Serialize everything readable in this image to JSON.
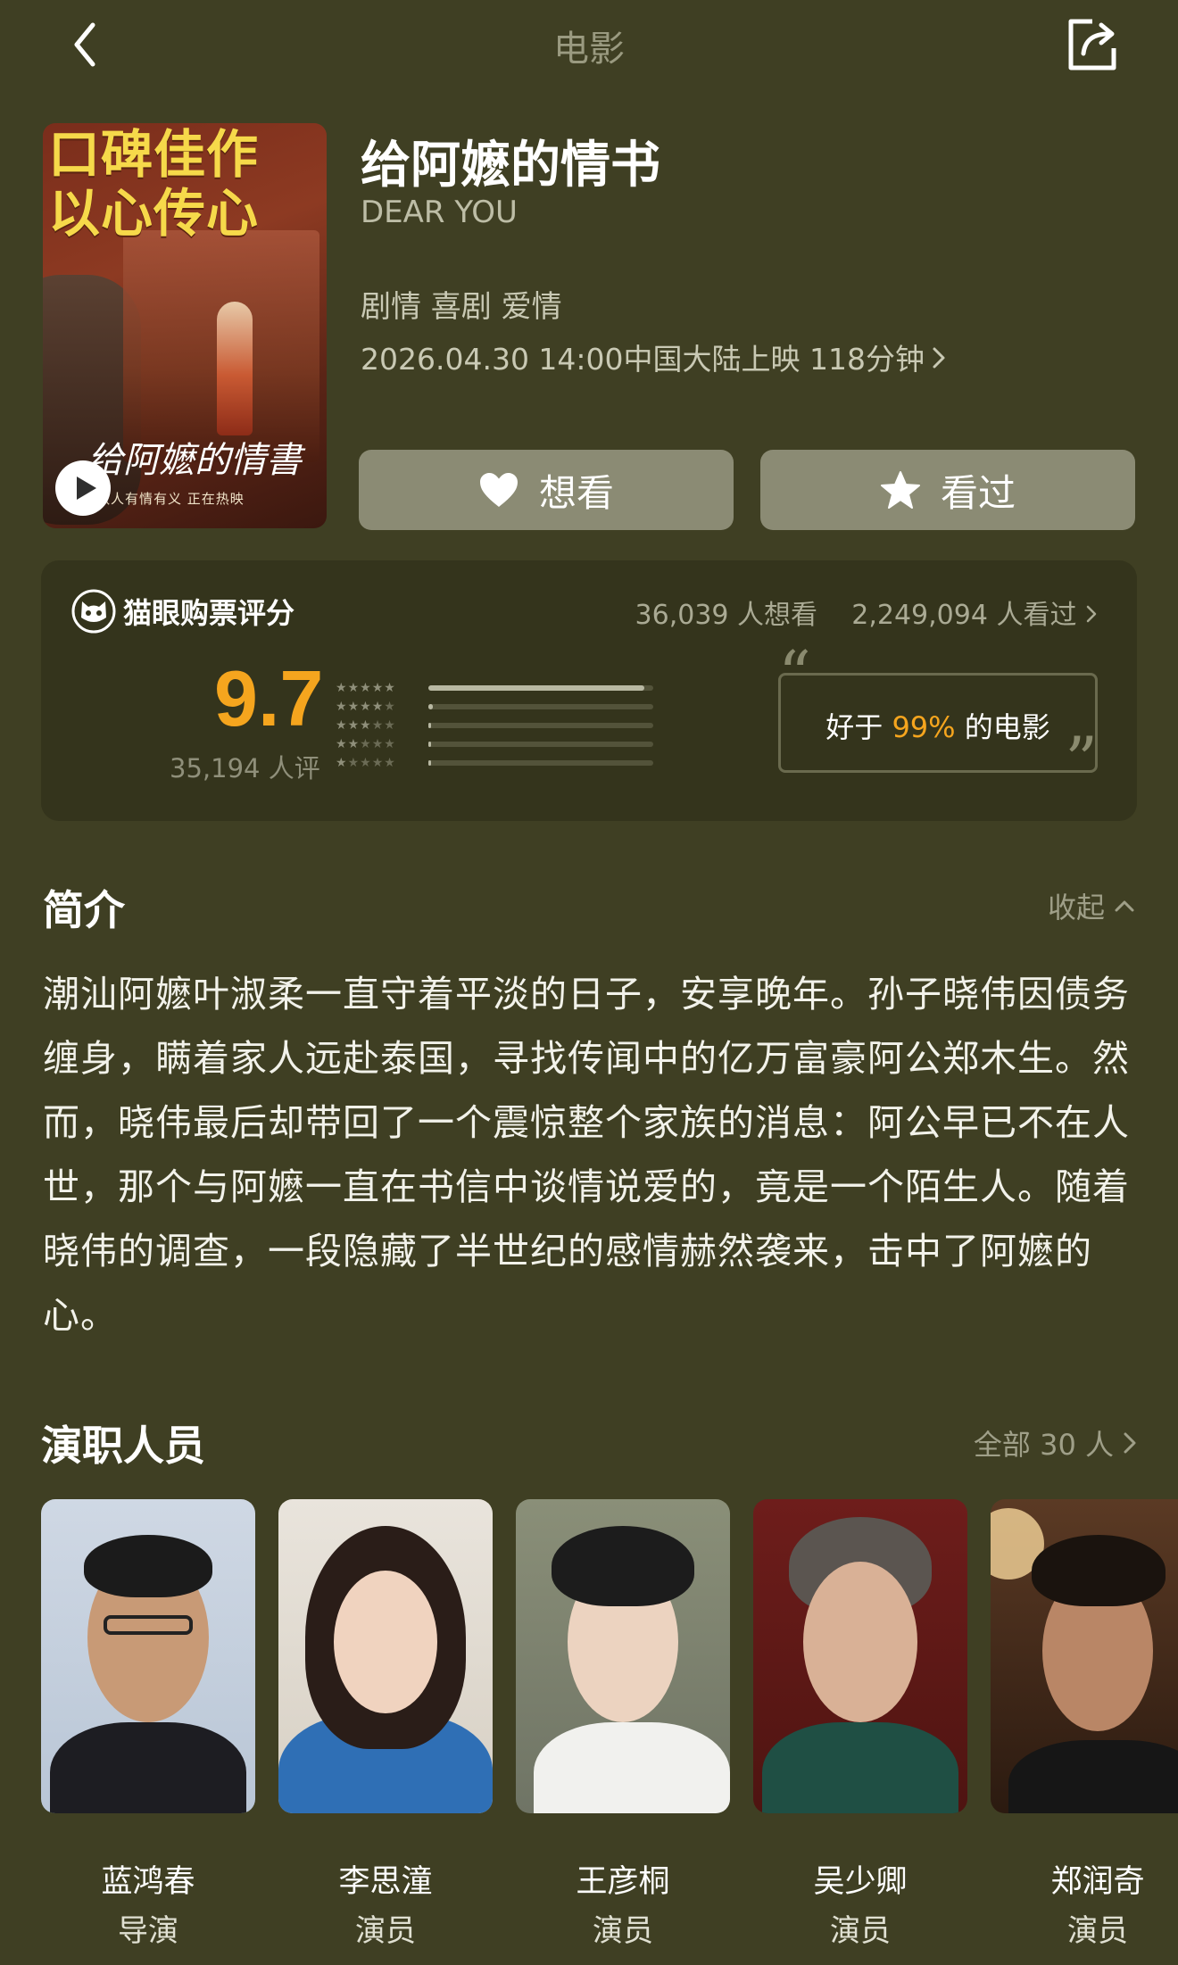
{
  "nav": {
    "title": "电影",
    "back_icon": "chevron-left-icon",
    "share_icon": "share-icon"
  },
  "poster": {
    "slogan_line1": "口碑佳作",
    "slogan_line2": "以心传心",
    "film_title": "给阿嬷的情書",
    "tagline": "做人有情有义  正在热映",
    "play_icon": "play-icon"
  },
  "movie": {
    "title": "给阿嬷的情书",
    "title_en": "DEAR YOU",
    "genres": "剧情 喜剧 爱情",
    "release": "2026.04.30 14:00中国大陆上映 118分钟"
  },
  "actions": {
    "want_label": "想看",
    "seen_label": "看过"
  },
  "rating": {
    "label": "猫眼购票评分",
    "want_count": "36,039 人想看",
    "seen_count": "2,249,094 人看过",
    "score": "9.7",
    "rating_count": "35,194 人评",
    "distribution": [
      0.96,
      0.02,
      0.01,
      0.005,
      0.01
    ],
    "better_prefix": "好于 ",
    "better_pct": "99%",
    "better_suffix": " 的电影",
    "accent_color": "#f5a51e"
  },
  "intro": {
    "title": "简介",
    "collapse_label": "收起",
    "text": "潮汕阿嬷叶淑柔一直守着平淡的日子，安享晚年。孙子晓伟因债务缠身，瞒着家人远赴泰国，寻找传闻中的亿万富豪阿公郑木生。然而，晓伟最后却带回了一个震惊整个家族的消息：阿公早已不在人世，那个与阿嬷一直在书信中谈情说爱的，竟是一个陌生人。随着晓伟的调查，一段隐藏了半世纪的感情赫然袭来，击中了阿嬷的心。"
  },
  "cast": {
    "title": "演职人员",
    "all_label": "全部 30 人",
    "members": [
      {
        "name": "蓝鸿春",
        "role": "导演"
      },
      {
        "name": "李思潼",
        "role": "演员"
      },
      {
        "name": "王彦桐",
        "role": "演员"
      },
      {
        "name": "吴少卿",
        "role": "演员"
      },
      {
        "name": "郑润奇",
        "role": "演员"
      }
    ]
  }
}
